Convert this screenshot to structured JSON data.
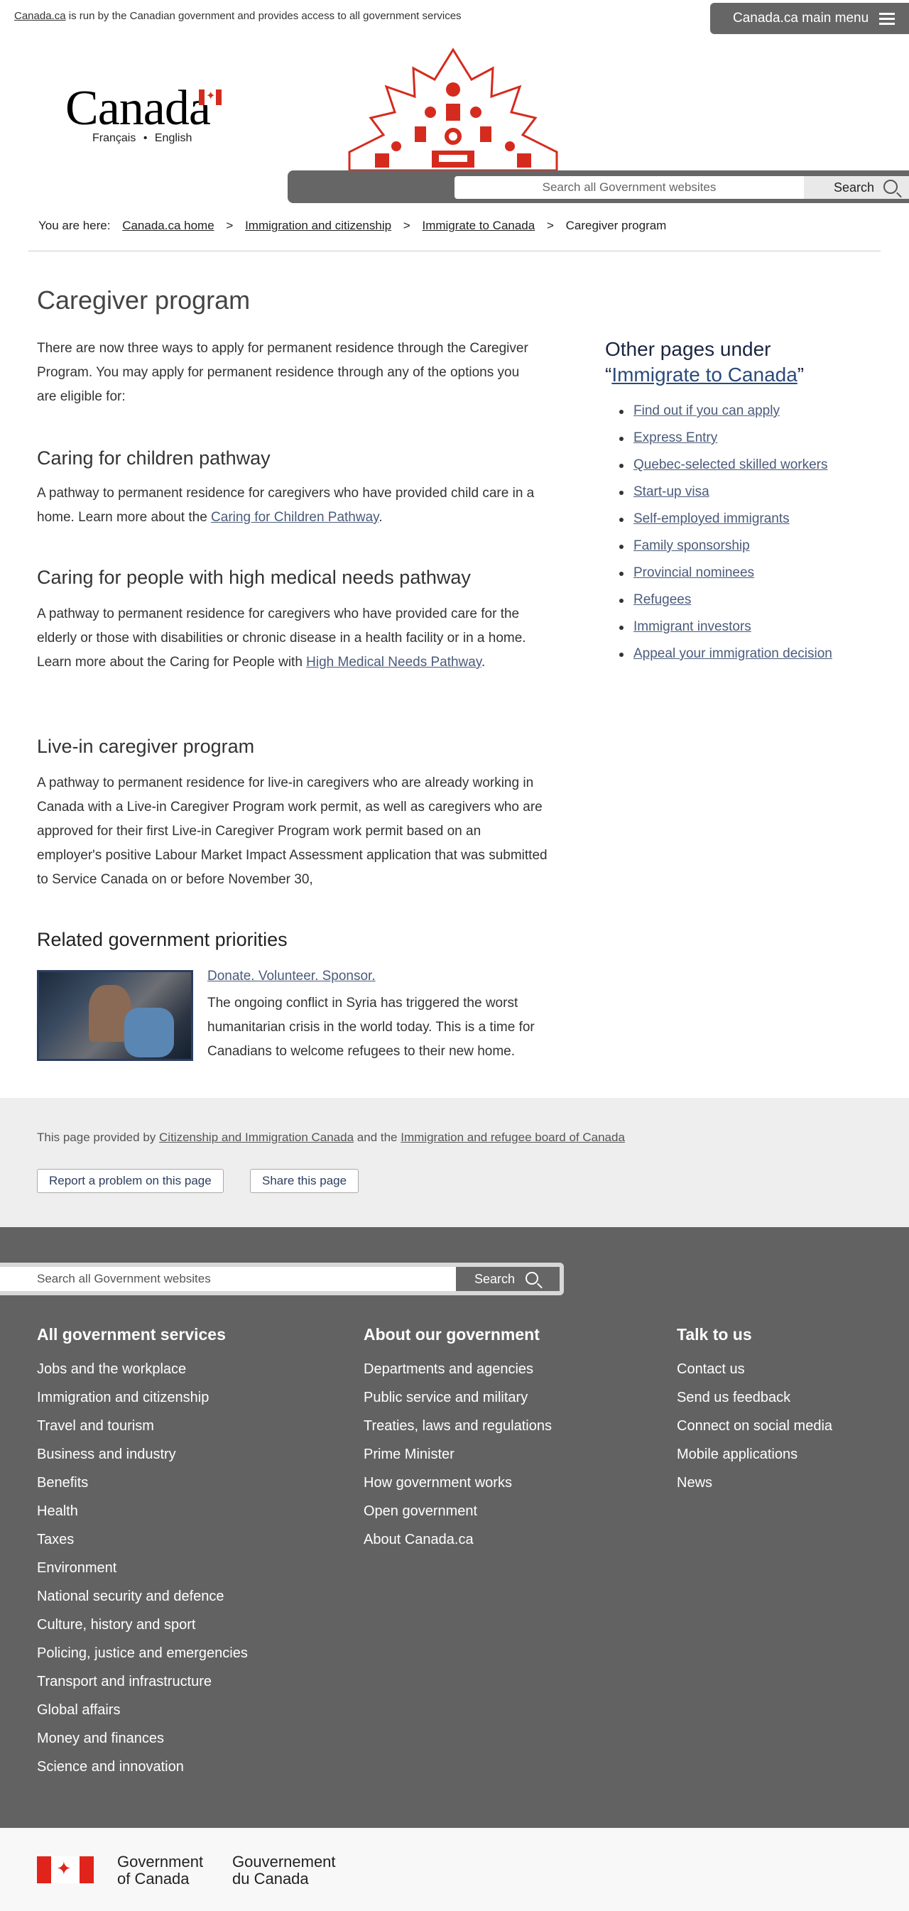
{
  "topbar": {
    "notice_link": "Canada.ca",
    "notice_text": "is run by the Canadian government and provides access to all government services",
    "main_menu_label": "Canada.ca main menu"
  },
  "header": {
    "wordmark": "Canada",
    "lang_fr": "Français",
    "lang_sep": "•",
    "lang_en": "English",
    "search_placeholder": "Search all Government websites",
    "search_button": "Search"
  },
  "breadcrumb": {
    "prefix": "You are here:",
    "items": [
      "Canada.ca home",
      "Immigration and citizenship",
      "Immigrate to Canada"
    ],
    "current": "Caregiver program",
    "sep": ">"
  },
  "main": {
    "title": "Caregiver program",
    "intro": "There are now three ways to apply for permanent residence through the Caregiver Program.  You may apply for permanent residence through any of the options you are eligible for:",
    "sections": [
      {
        "heading": "Caring for children pathway",
        "text_before": "A pathway to permanent residence for caregivers who have provided child care in a home. Learn more about the ",
        "link": "Caring for Children Pathway",
        "text_after": "."
      },
      {
        "heading": "Caring for people with high medical needs pathway",
        "text_before": "A pathway to permanent residence for caregivers who have provided care for the elderly or those with disabilities or chronic disease in a health facility or in a home. Learn more about the Caring for People with ",
        "link": "High Medical Needs Pathway",
        "text_after": "."
      },
      {
        "heading": "Live-in caregiver program",
        "text": "A pathway to permanent residence for live-in caregivers who are already working in Canada with a Live-in Caregiver Program work permit, as well as caregivers who are approved for their first Live-in Caregiver Program work permit based on an employer's positive Labour Market Impact Assessment application that was submitted to Service Canada on or before November 30,"
      }
    ],
    "related": {
      "heading": "Related government priorities",
      "link": "Donate. Volunteer. Sponsor.",
      "text": "The ongoing conflict in Syria has triggered the worst humanitarian crisis in the world today.  This is a time for Canadians to welcome refugees to their new home."
    }
  },
  "sidebar": {
    "heading_prefix": "Other pages under",
    "heading_open_quote": "“",
    "heading_link": "Immigrate to Canada",
    "heading_close_quote": "”",
    "items": [
      "Find out if you can apply",
      "Express Entry",
      "Quebec-selected skilled workers",
      "Start-up visa",
      "Self-employed immigrants",
      "Family sponsorship",
      "Provincial nominees",
      "Refugees",
      "Immigrant investors",
      "Appeal your immigration decision"
    ]
  },
  "provided": {
    "text1": "This page provided by",
    "link1": "Citizenship and Immigration Canada",
    "text2": "and the",
    "link2": "Immigration and refugee board of Canada",
    "report_button": "Report a problem on this page",
    "share_button": "Share this page"
  },
  "footer": {
    "search_placeholder": "Search all Government websites",
    "search_button": "Search",
    "col1": {
      "heading": "All government services",
      "items": [
        "Jobs and the workplace",
        "Immigration and citizenship",
        "Travel and tourism",
        "Business and industry",
        "Benefits",
        "Health",
        "Taxes",
        "Environment",
        "National security and defence",
        "Culture, history and sport",
        "Policing, justice and emergencies",
        "Transport and infrastructure",
        "Global affairs",
        "Money and finances",
        "Science and innovation"
      ]
    },
    "col2": {
      "heading": "About our government",
      "items": [
        "Departments and agencies",
        "Public service and military",
        "Treaties, laws and regulations",
        "Prime Minister",
        "How government works",
        "Open government",
        "About Canada.ca"
      ]
    },
    "col3": {
      "heading": "Talk to us",
      "items": [
        "Contact us",
        "Send us feedback",
        "Connect on social media",
        "Mobile applications",
        "News"
      ]
    },
    "gov_en_1": "Government",
    "gov_en_2": "of Canada",
    "gov_fr_1": "Gouvernement",
    "gov_fr_2": "du Canada"
  },
  "colors": {
    "accent_red": "#d52b1e",
    "link": "#4a5b7a",
    "dark_gray": "#666666",
    "footer_bg": "#626262"
  }
}
